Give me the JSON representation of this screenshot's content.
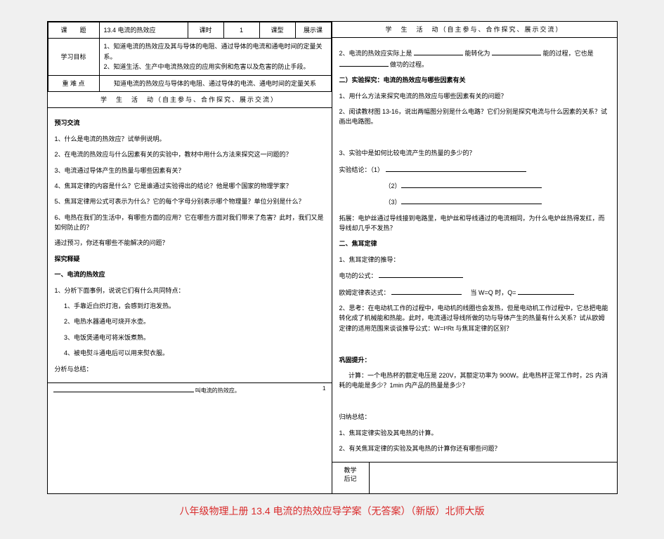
{
  "meta": {
    "topic_label": "课　　题",
    "topic": "13.4 电流的热效应",
    "period_label": "课时",
    "period_value": "1",
    "type_label": "课型",
    "type_value": "展示课",
    "goal_label": "学习目标",
    "goal": "1、知道电流的热效应及其与导体的电阻、通过导体的电流和通电时间的定量关系。\n2、知道生活、生产中电流热效应的应用实例和危害以及危害的防止手段。",
    "keypoint_label": "重 难 点",
    "keypoint": "知道电流的热效应与导体的电阻、通过导体的电流、通电时间的定量关系",
    "activity_header": "学　生　活　动（自主参与、合作探究、展示交流）"
  },
  "left": {
    "h_preview": "预习交流",
    "q1": "1、什么是电流的热效应？试举例说明。",
    "q2": "2、在电流的热效应与什么因素有关的实验中，教材中用什么方法来探究这一问题的？",
    "q3": "3、电流通过导体产生的热量与哪些因素有关？",
    "q4": "4、焦耳定律的内容是什么？它是谁通过实验得出的结论？他是哪个国家的物理学家？",
    "q5": "5、焦耳定律用公式可表示为什么？它的每个字母分别表示哪个物理量？单位分别是什么？",
    "q6": "6、电热在我们的生活中，有哪些方面的应用？它在哪些方面对我们带来了危害？此时，我们又是如何防止的？",
    "q7": "通过预习，你还有哪些不能解决的问题？",
    "h_explore": "探究释疑",
    "h_one": "一、电流的热效应",
    "p_analyze": "1、分析下面事例，说说它们有什么共同特点：",
    "e1": "1、手靠近白炽灯泡，会感到灯泡发热。",
    "e2": "2、电热水器通电可烧开水壶。",
    "e3": "3、电饭煲通电可将米饭煮熟。",
    "e4": "4、被电熨斗通电后可以用来熨衣服。",
    "p_conclude": "分析与总结：",
    "p_call": "叫电流的热效应。",
    "page_num_lbl": "1"
  },
  "right": {
    "activity_header": "学　生　活　动（自主参与、合作探究、展示交流）",
    "p2": "2、电流的热效应实际上是",
    "p2a": "能转化为",
    "p2b": "能的过程，它也是",
    "p2c": "做功的过程。",
    "h_two": "二）实验探究：电流的热效应与哪些因素有关",
    "r1": "1、用什么方法来探究电流的热效应与哪些因素有关的问题？",
    "r2": "2、阅读教材图 13-16，说出两幅图分别是什么电路？它们分别是探究电流与什么因素的关系？试画出电路图。",
    "r3": "3、实验中是如何比较电流产生的热量的多少的？",
    "r_conc": "实验结论：（1）",
    "r_ext": "拓展：电炉丝通过导线接到电路里，电炉丝和导线通过的电流相同，为什么电炉丝热得发红，而导线却几乎不发热？",
    "h_joule": "二、焦耳定律",
    "j1": "1、焦耳定律的推导：",
    "j_w": "电功的公式：",
    "j_ohm": "欧姆定律表达式：",
    "j_when": "当 W=Q 时，Q=",
    "j2": "2、思考：在电动机工作的过程中，电动机的线圈也会发热，但是电动机工作过程中，它总把电能转化成了机械能和热能。此时，电流通过导线所做的功与导体产生的热量有什么关系？试从欧姆定律的适用范围来谈谈推导公式：W=I²Rt 与焦耳定律的区别？",
    "h_consolidate": "巩固提升：",
    "calc": "计算：一个电热杯的额定电压是 220V，其额定功率为 900W。此电热杯正常工作时，2S 内消耗的电能是多少？1min 内产品的热量是多少？",
    "h_summary": "归纳总结：",
    "s1": "1、焦耳定律实验及其电热的计算。",
    "s2": "2、有关焦耳定律的实验及其电热的计算你还有哪些问题？",
    "after_label": "教学\n后记"
  },
  "caption": "八年级物理上册 13.4 电流的热效应导学案（无答案）（新版）北师大版"
}
